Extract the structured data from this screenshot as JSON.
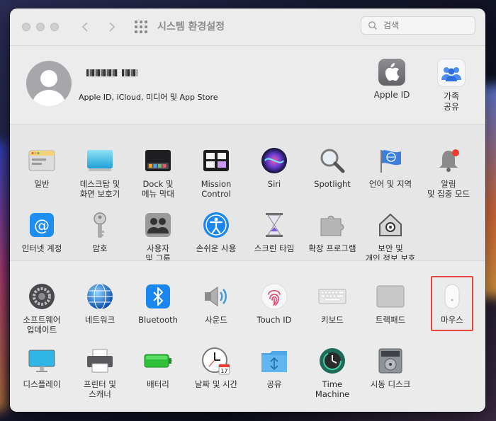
{
  "window": {
    "title": "시스템 환경설정",
    "search_placeholder": "검색"
  },
  "account": {
    "subtitle": "Apple ID, iCloud, 미디어 및 App Store",
    "items": [
      {
        "name": "Apple ID",
        "lines": [
          "Apple ID"
        ]
      },
      {
        "name": "가족 공유",
        "lines": [
          "가족",
          "공유"
        ]
      }
    ]
  },
  "section1": [
    {
      "lines": [
        "일반"
      ],
      "icon": "general-icon"
    },
    {
      "lines": [
        "데스크탑 및",
        "화면 보호기"
      ],
      "icon": "desktop-icon"
    },
    {
      "lines": [
        "Dock 및",
        "메뉴 막대"
      ],
      "icon": "dock-icon"
    },
    {
      "lines": [
        "Mission",
        "Control"
      ],
      "icon": "mission-control-icon"
    },
    {
      "lines": [
        "Siri"
      ],
      "icon": "siri-icon"
    },
    {
      "lines": [
        "Spotlight"
      ],
      "icon": "spotlight-icon"
    },
    {
      "lines": [
        "언어 및 지역"
      ],
      "icon": "language-icon"
    },
    {
      "lines": [
        "알림",
        "및 집중 모드"
      ],
      "icon": "notification-icon"
    },
    {
      "lines": [
        "인터넷 계정"
      ],
      "icon": "internet-accounts-icon"
    },
    {
      "lines": [
        "암호"
      ],
      "icon": "password-icon"
    },
    {
      "lines": [
        "사용자",
        "및 그룹"
      ],
      "icon": "users-icon"
    },
    {
      "lines": [
        "손쉬운 사용"
      ],
      "icon": "accessibility-icon"
    },
    {
      "lines": [
        "스크린 타임"
      ],
      "icon": "screen-time-icon"
    },
    {
      "lines": [
        "확장 프로그램"
      ],
      "icon": "extensions-icon"
    },
    {
      "lines": [
        "보안 및",
        "개인 정보 보호"
      ],
      "icon": "security-icon"
    }
  ],
  "section2": [
    {
      "lines": [
        "소프트웨어",
        "업데이트"
      ],
      "icon": "software-update-icon"
    },
    {
      "lines": [
        "네트워크"
      ],
      "icon": "network-icon"
    },
    {
      "lines": [
        "Bluetooth"
      ],
      "icon": "bluetooth-icon"
    },
    {
      "lines": [
        "사운드"
      ],
      "icon": "sound-icon"
    },
    {
      "lines": [
        "Touch ID"
      ],
      "icon": "touch-id-icon"
    },
    {
      "lines": [
        "키보드"
      ],
      "icon": "keyboard-icon"
    },
    {
      "lines": [
        "트랙패드"
      ],
      "icon": "trackpad-icon"
    },
    {
      "lines": [
        "마우스"
      ],
      "icon": "mouse-icon"
    },
    {
      "lines": [
        "디스플레이"
      ],
      "icon": "display-icon"
    },
    {
      "lines": [
        "프린터 및",
        "스캐너"
      ],
      "icon": "printer-icon"
    },
    {
      "lines": [
        "배터리"
      ],
      "icon": "battery-icon"
    },
    {
      "lines": [
        "날짜 및 시간"
      ],
      "icon": "clock-icon"
    },
    {
      "lines": [
        "공유"
      ],
      "icon": "sharing-icon"
    },
    {
      "lines": [
        "Time",
        "Machine"
      ],
      "icon": "time-machine-icon"
    },
    {
      "lines": [
        "시동 디스크"
      ],
      "icon": "startup-disk-icon"
    }
  ],
  "clock_date": "17"
}
